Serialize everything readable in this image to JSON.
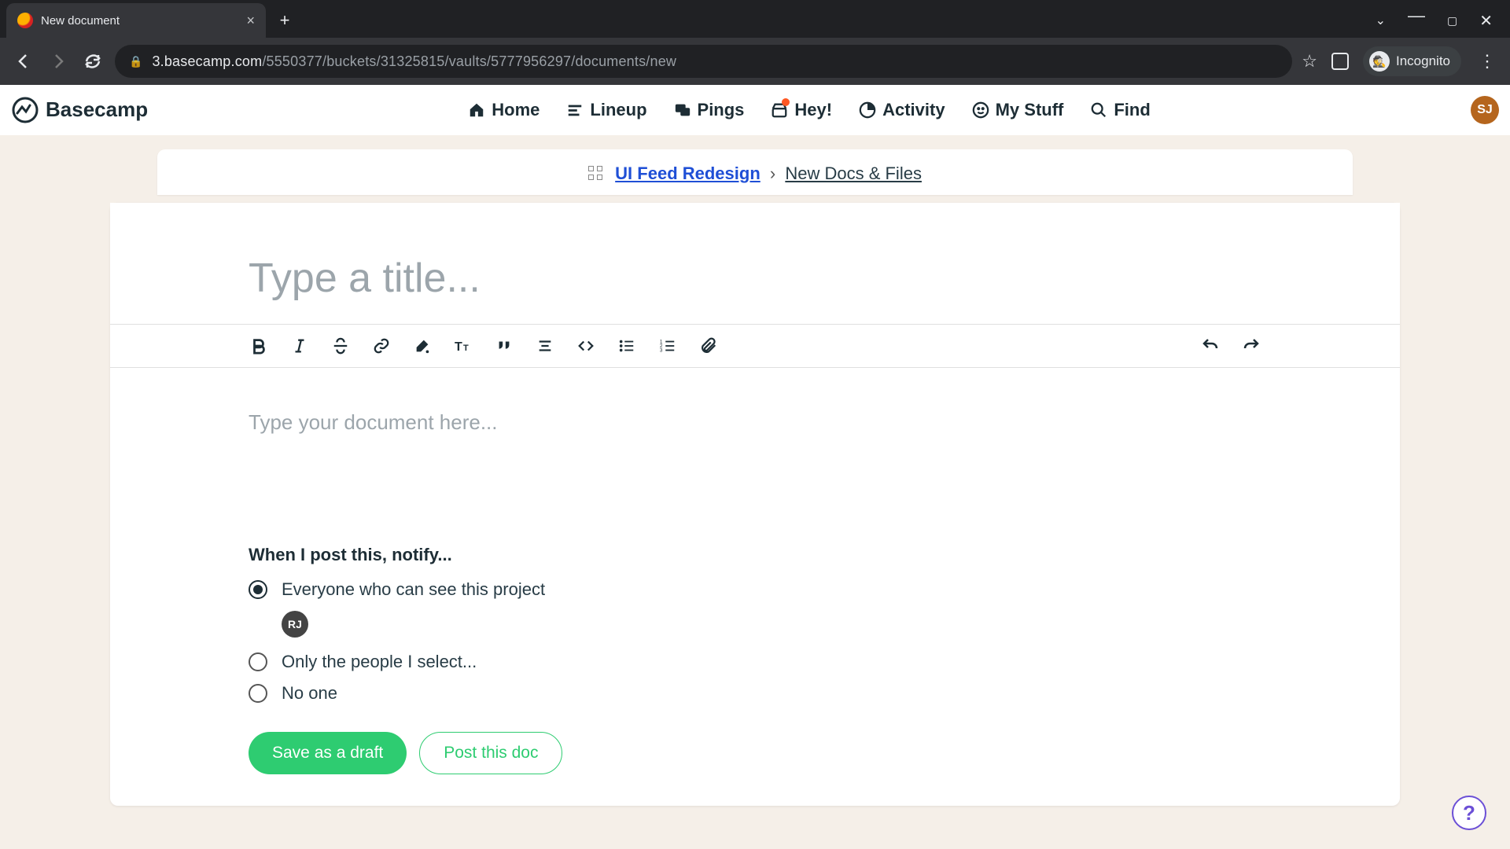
{
  "browser": {
    "tab_title": "New document",
    "url_host": "3.basecamp.com",
    "url_path": "/5550377/buckets/31325815/vaults/5777956297/documents/new",
    "incognito_label": "Incognito"
  },
  "header": {
    "brand": "Basecamp",
    "nav": {
      "home": "Home",
      "lineup": "Lineup",
      "pings": "Pings",
      "hey": "Hey!",
      "activity": "Activity",
      "mystuff": "My Stuff",
      "find": "Find"
    },
    "avatar_initials": "SJ"
  },
  "breadcrumb": {
    "project": "UI Feed Redesign",
    "separator": "›",
    "section": "New Docs & Files"
  },
  "editor": {
    "title_placeholder": "Type a title...",
    "body_placeholder": "Type your document here..."
  },
  "notify": {
    "heading": "When I post this, notify...",
    "options": {
      "everyone": "Everyone who can see this project",
      "select": "Only the people I select...",
      "noone": "No one"
    },
    "selected": "everyone",
    "member_initials": "RJ"
  },
  "actions": {
    "draft": "Save as a draft",
    "post": "Post this doc"
  },
  "help_label": "?"
}
